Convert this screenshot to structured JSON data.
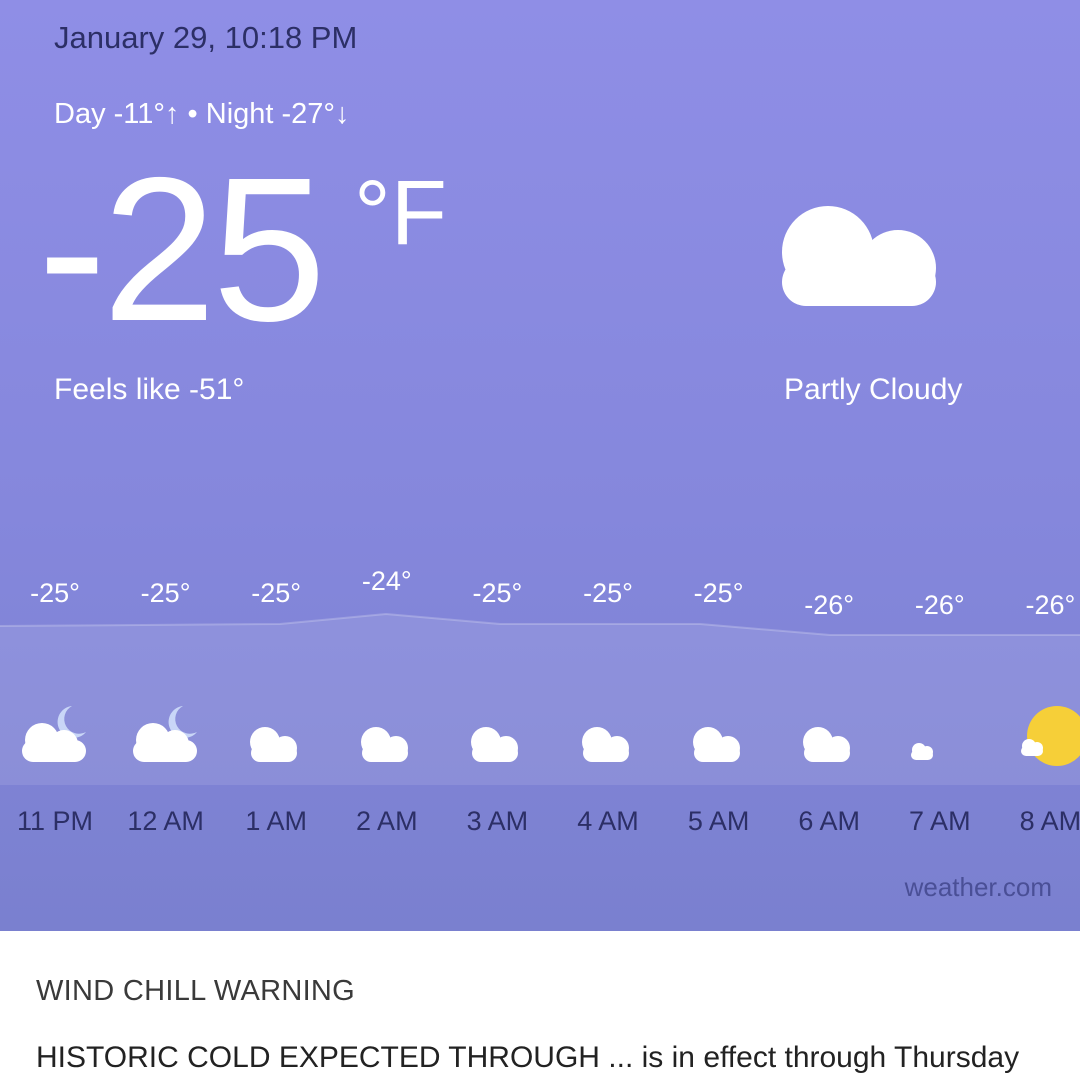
{
  "header": {
    "date_time": "January 29, 10:18 PM",
    "day_night": "Day -11°↑ • Night -27°↓"
  },
  "current": {
    "temperature": "-25",
    "unit": "°F",
    "feels_like": "Feels like -51°",
    "condition": "Partly Cloudy",
    "condition_icon": "moon-cloud-icon"
  },
  "hourly": [
    {
      "time": "11 PM",
      "temp": "-25°",
      "icon": "cloud-moon-icon"
    },
    {
      "time": "12 AM",
      "temp": "-25°",
      "icon": "cloud-moon-icon"
    },
    {
      "time": "1 AM",
      "temp": "-25°",
      "icon": "moon-cloud-icon"
    },
    {
      "time": "2 AM",
      "temp": "-24°",
      "icon": "moon-cloud-icon"
    },
    {
      "time": "3 AM",
      "temp": "-25°",
      "icon": "moon-cloud-icon"
    },
    {
      "time": "4 AM",
      "temp": "-25°",
      "icon": "moon-cloud-icon"
    },
    {
      "time": "5 AM",
      "temp": "-25°",
      "icon": "moon-cloud-icon"
    },
    {
      "time": "6 AM",
      "temp": "-26°",
      "icon": "moon-cloud-icon"
    },
    {
      "time": "7 AM",
      "temp": "-26°",
      "icon": "moon-small-cloud-icon"
    },
    {
      "time": "8 AM",
      "temp": "-26°",
      "icon": "sun-cloud-icon"
    }
  ],
  "attribution": "weather.com",
  "alert": {
    "title": "WIND CHILL WARNING",
    "text": "HISTORIC COLD EXPECTED THROUGH ... is in effect through Thursday"
  },
  "colors": {
    "card_top": "#8f8ee6",
    "card_bottom": "#7a80cf",
    "dark_text": "#2c2f66",
    "moon": "#c9d6f7",
    "cloud": "#ffffff",
    "sun": "#f6cf38"
  }
}
